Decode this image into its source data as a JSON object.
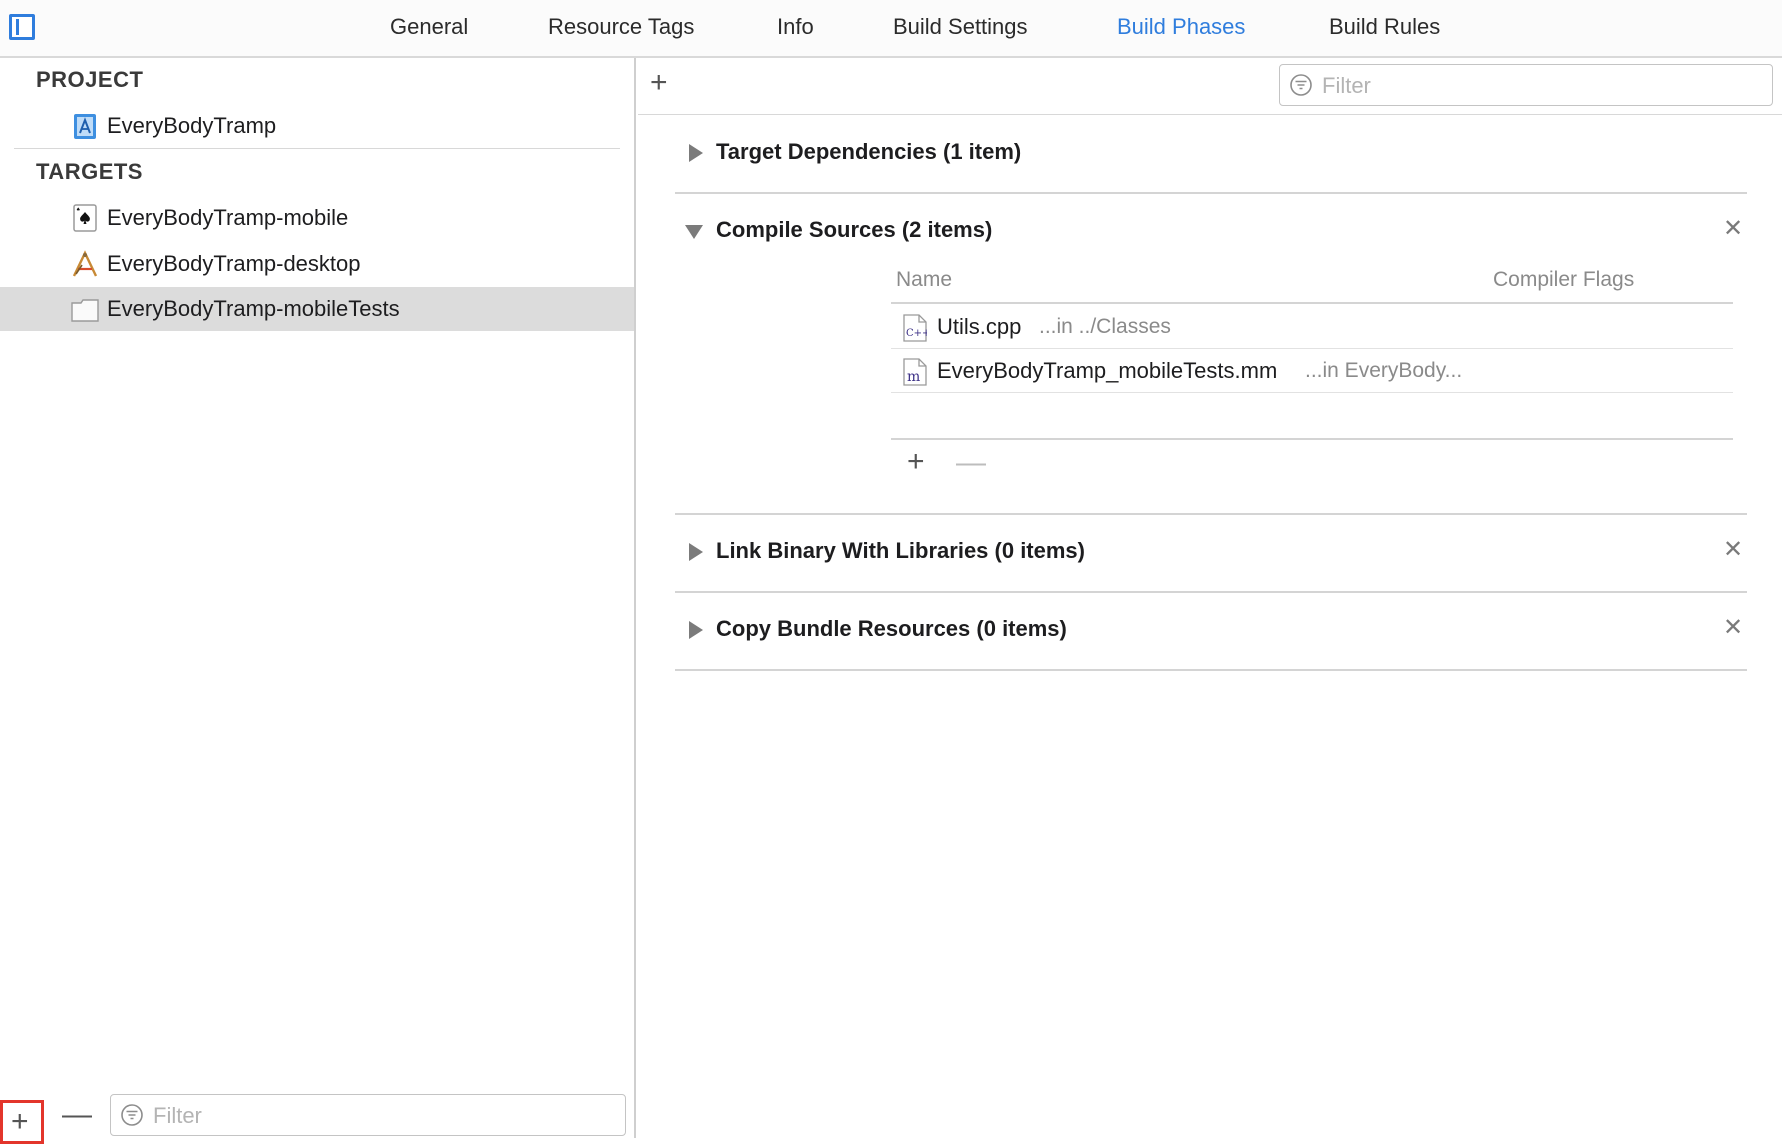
{
  "tabs": [
    {
      "label": "General"
    },
    {
      "label": "Resource Tags"
    },
    {
      "label": "Info"
    },
    {
      "label": "Build Settings"
    },
    {
      "label": "Build Phases"
    },
    {
      "label": "Build Rules"
    }
  ],
  "active_tab": "Build Phases",
  "sidebar": {
    "project_header": "PROJECT",
    "project": {
      "label": "EveryBodyTramp",
      "icon": "xcode-project-icon"
    },
    "targets_header": "TARGETS",
    "targets": [
      {
        "label": "EveryBodyTramp-mobile",
        "icon": "ios-app-icon"
      },
      {
        "label": "EveryBodyTramp-desktop",
        "icon": "mac-app-icon"
      },
      {
        "label": "EveryBodyTramp-mobileTests",
        "icon": "test-bundle-icon"
      }
    ],
    "selected_target": "EveryBodyTramp-mobileTests",
    "filter_placeholder": "Filter"
  },
  "content": {
    "filter_placeholder": "Filter",
    "phases": [
      {
        "title": "Target Dependencies (1 item)",
        "expanded": false,
        "removable": false
      },
      {
        "title": "Compile Sources (2 items)",
        "expanded": true,
        "removable": true,
        "columns": {
          "name": "Name",
          "flags": "Compiler Flags"
        },
        "files": [
          {
            "name": "Utils.cpp",
            "path": "...in ../Classes",
            "icon": "cpp-file-icon"
          },
          {
            "name": "EveryBodyTramp_mobileTests.mm",
            "path": "...in EveryBody...",
            "icon": "objc-file-icon"
          }
        ]
      },
      {
        "title": "Link Binary With Libraries (0 items)",
        "expanded": false,
        "removable": true
      },
      {
        "title": "Copy Bundle Resources (0 items)",
        "expanded": false,
        "removable": true
      }
    ]
  },
  "colors": {
    "accent": "#2f7ddd",
    "highlight": "#e3352b",
    "selection": "#dcdcdc"
  }
}
